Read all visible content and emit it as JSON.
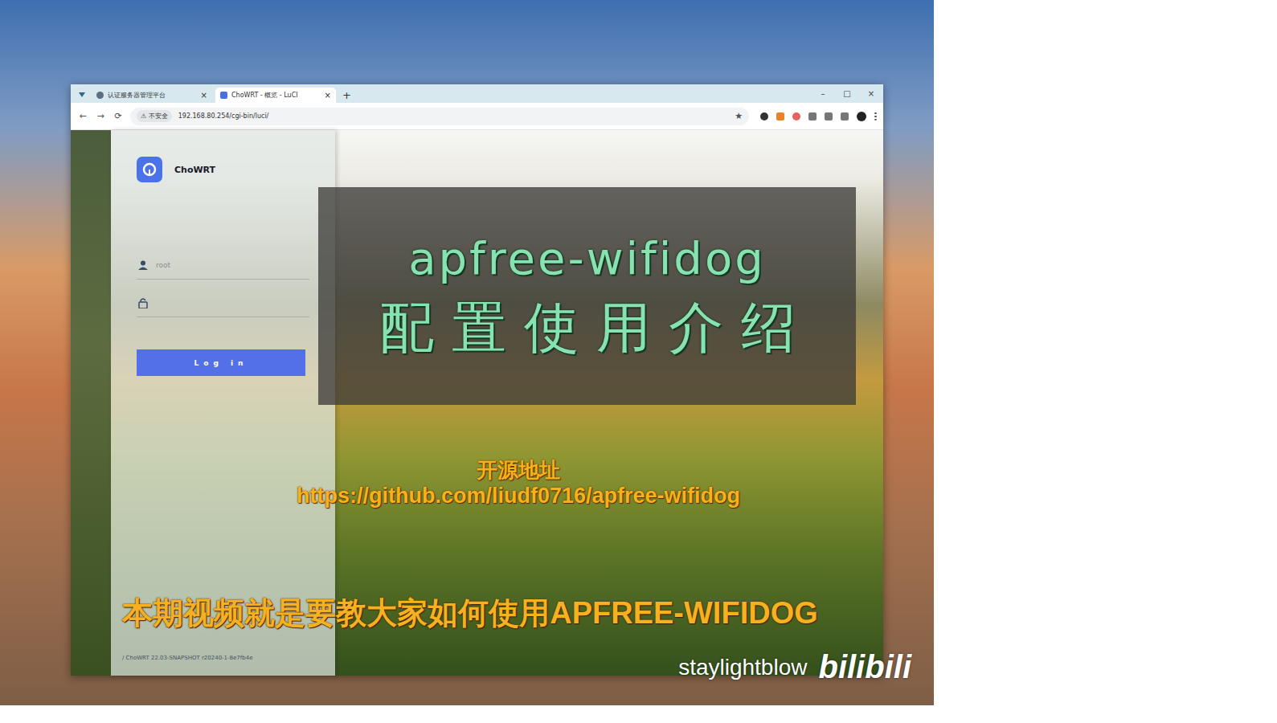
{
  "browser": {
    "tabs": [
      {
        "label": "认证服务器管理平台",
        "selected": false,
        "close": "×"
      },
      {
        "label": "ChoWRT - 概览 - LuCI",
        "selected": true,
        "close": "×"
      }
    ],
    "new_tab": "+",
    "window_controls": [
      "–",
      "□",
      "×"
    ],
    "nav": [
      "←",
      "→",
      "⟳"
    ],
    "security": "不安全",
    "url": "192.168.80.254/cgi-bin/luci/"
  },
  "login": {
    "brand": "ChoWRT",
    "username_placeholder": "root",
    "button": "Log in",
    "footer": "/ ChoWRT 22.03-SNAPSHOT r20240-1-8e7fb4e"
  },
  "title_card": {
    "line1": "apfree-wifidog",
    "line2": "配置使用介绍"
  },
  "source": {
    "label": "开源地址",
    "url": "https://github.com/liudf0716/apfree-wifidog"
  },
  "subtitle": "本期视频就是要教大家如何使用APFREE-WIFIDOG",
  "watermark": {
    "channel": "staylightblow",
    "site": "bilibili"
  }
}
